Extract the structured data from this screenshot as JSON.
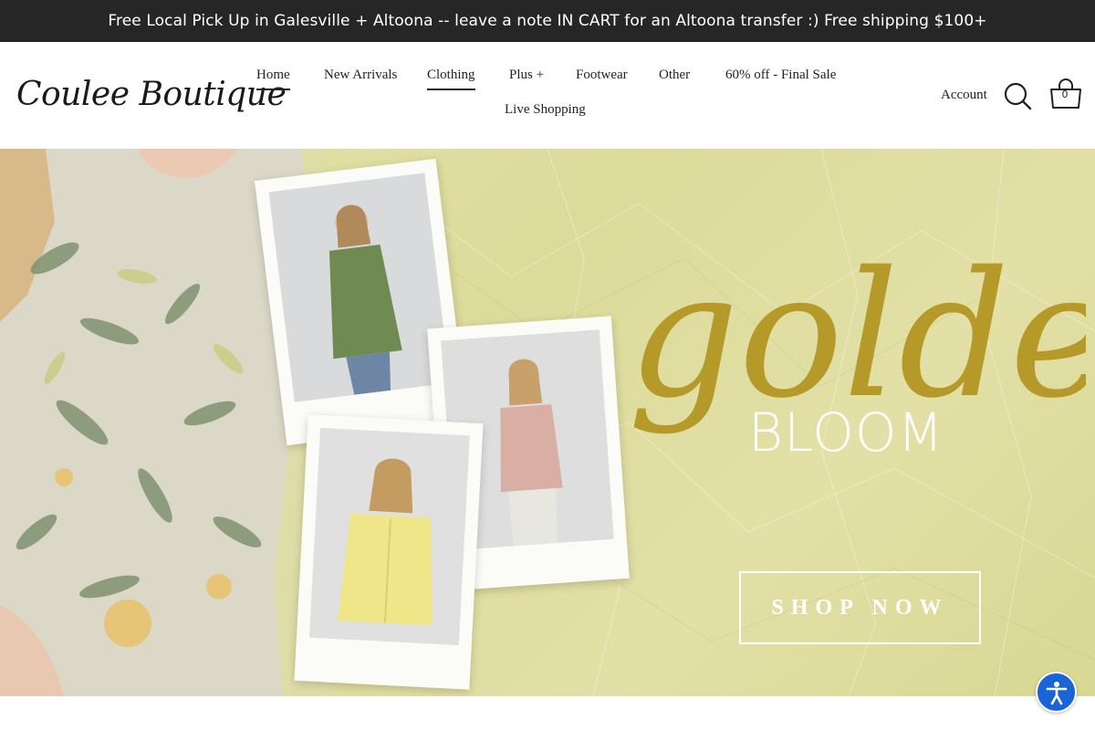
{
  "announcement": {
    "text": "Free Local Pick Up in Galesville + Altoona -- leave a note IN CART for an Altoona transfer :) Free shipping $100+"
  },
  "header": {
    "logo_text": "Coulee Boutique",
    "nav": [
      {
        "label": "Home",
        "active": true
      },
      {
        "label": "New Arrivals",
        "active": false
      },
      {
        "label": "Clothing",
        "active": true
      },
      {
        "label": "Plus +",
        "active": false
      },
      {
        "label": "Footwear",
        "active": false
      },
      {
        "label": "Other",
        "active": false
      },
      {
        "label": "60% off - Final Sale",
        "active": false
      },
      {
        "label": "Live Shopping",
        "active": false
      }
    ],
    "account_label": "Account",
    "cart_count": "0"
  },
  "hero": {
    "script_word": "golden",
    "headline": "BLOOM",
    "cta_label": "SHOP NOW"
  },
  "colors": {
    "announcement_bg": "#262626",
    "hero_bg": "#e0dfa2",
    "script_gold": "#b59a2a",
    "accessibility_blue": "#1a64d6"
  },
  "icons": [
    "search-icon",
    "cart-icon",
    "accessibility-icon"
  ]
}
